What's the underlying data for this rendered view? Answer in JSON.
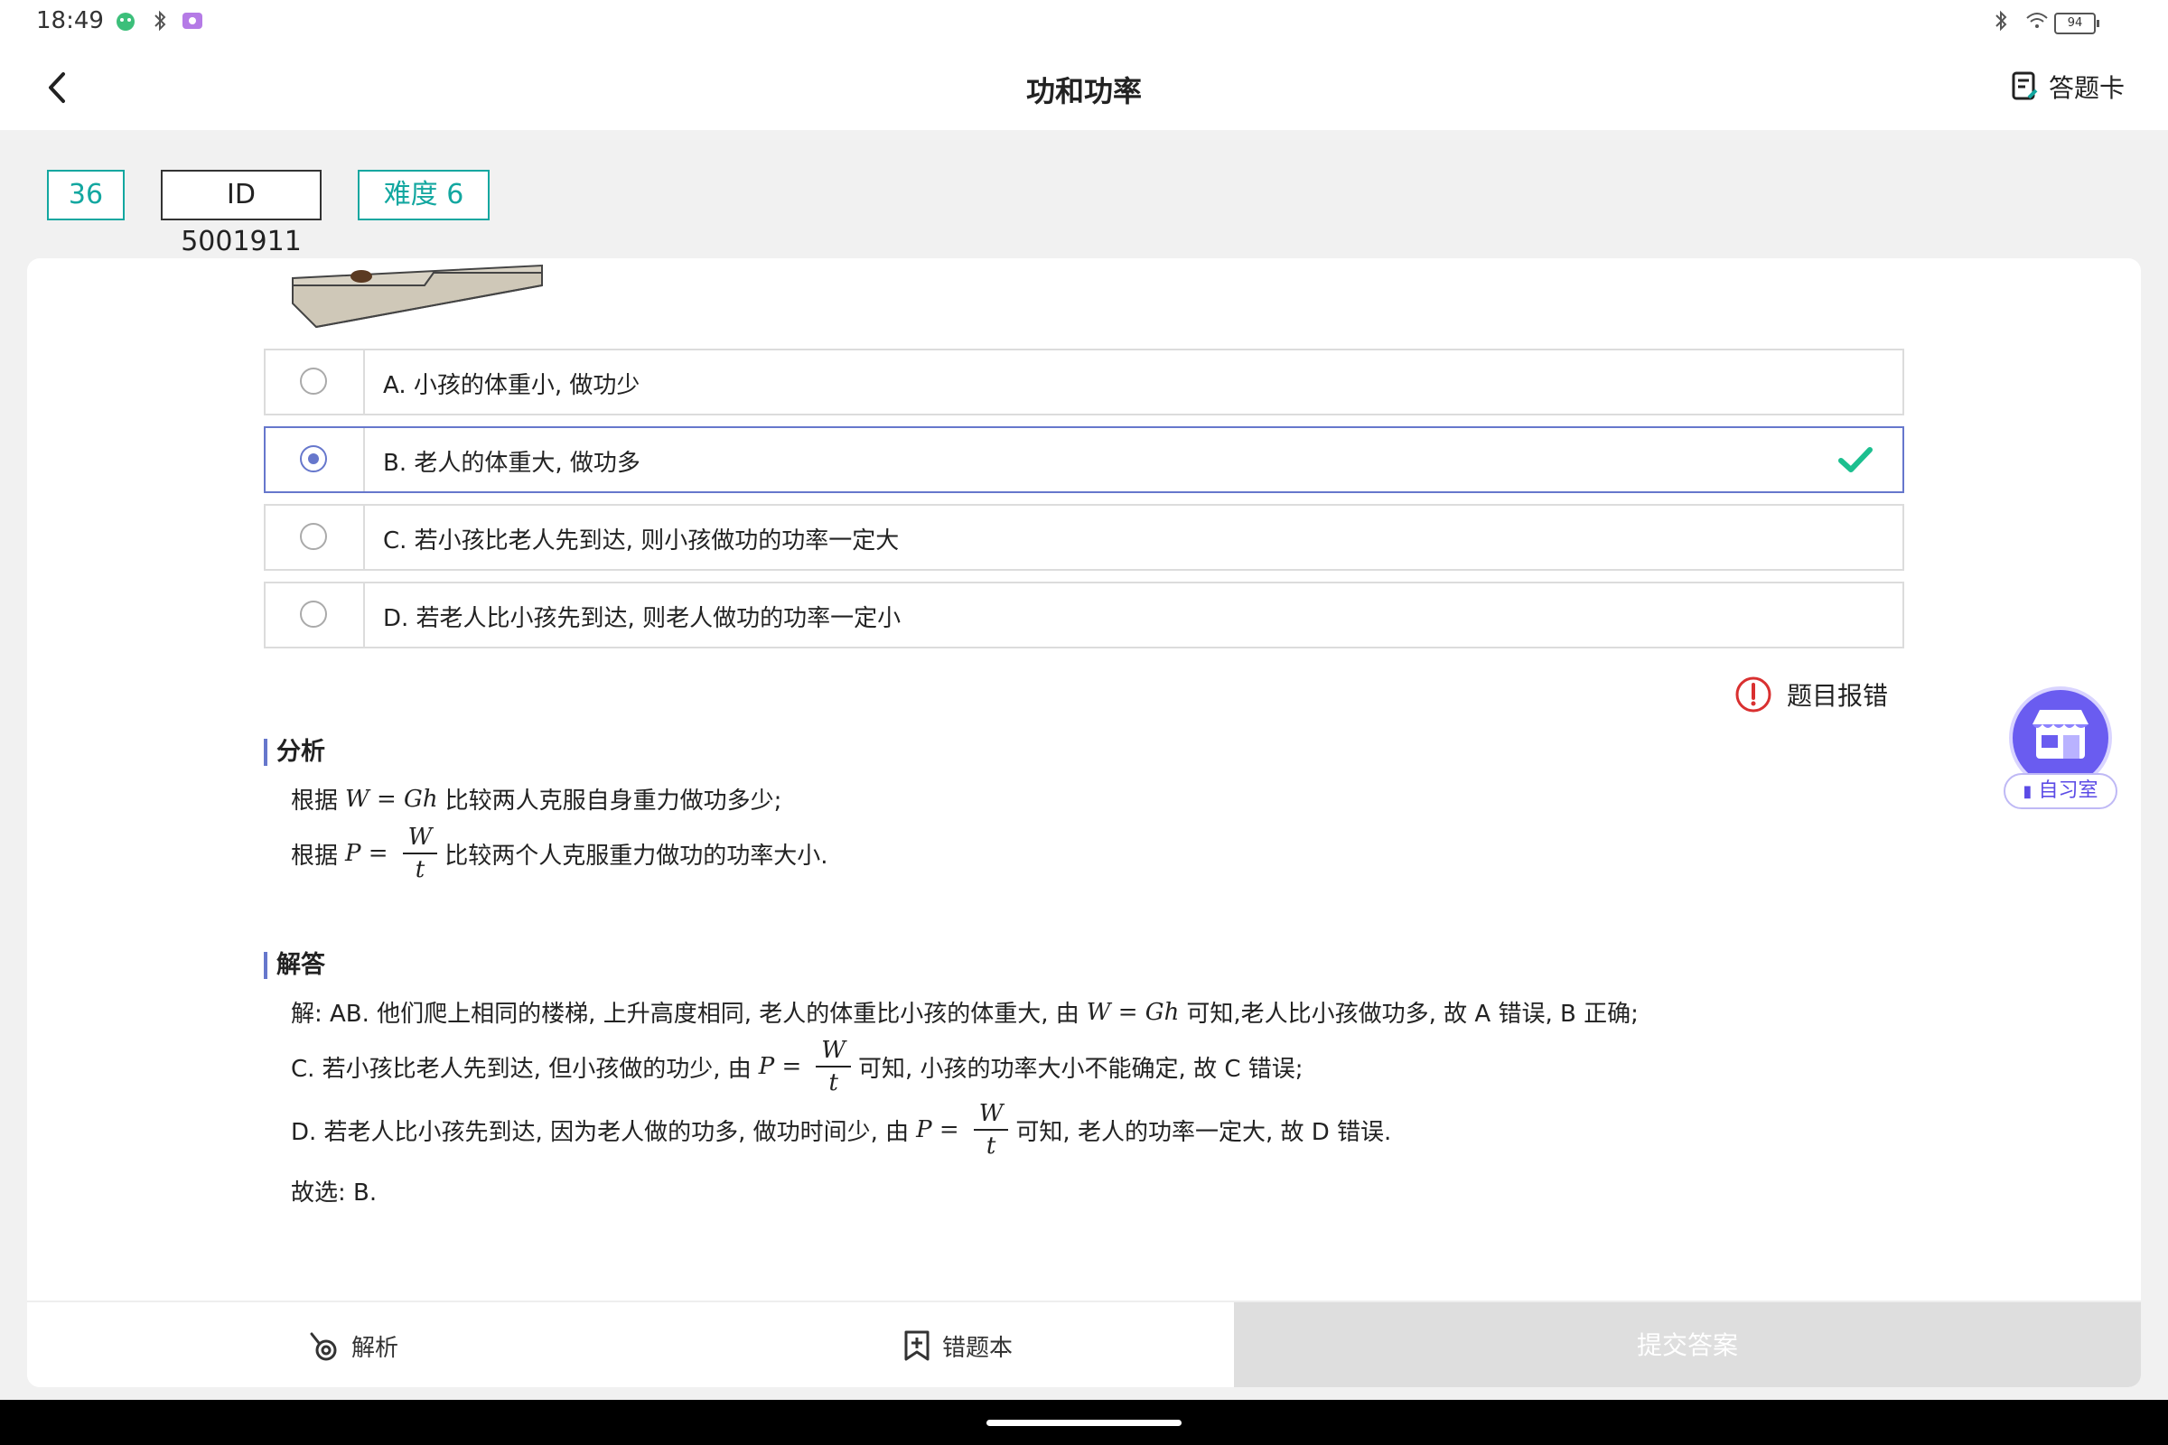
{
  "status_bar": {
    "time": "18:49",
    "battery": "94"
  },
  "header": {
    "title": "功和功率",
    "answer_card_label": "答题卡"
  },
  "tags": {
    "number": "36",
    "id": "ID 5001911",
    "difficulty": "难度 6"
  },
  "options": [
    {
      "text": "A. 小孩的体重小, 做功少",
      "selected": false
    },
    {
      "text": "B. 老人的体重大, 做功多",
      "selected": true,
      "correct": true
    },
    {
      "text": "C. 若小孩比老人先到达, 则小孩做功的功率一定大",
      "selected": false
    },
    {
      "text": "D. 若老人比小孩先到达, 则老人做功的功率一定小",
      "selected": false
    }
  ],
  "report_label": "题目报错",
  "analysis": {
    "heading": "分析",
    "line1_pre": "根据",
    "line1_formula": "W = Gh",
    "line1_post": "比较两人克服自身重力做功多少;",
    "line2_pre": "根据",
    "line2_lhs": "P =",
    "line2_num": "W",
    "line2_den": "t",
    "line2_post": "比较两个人克服重力做功的功率大小."
  },
  "solution": {
    "heading": "解答",
    "line1_pre": "解: AB. 他们爬上相同的楼梯, 上升高度相同, 老人的体重比小孩的体重大, 由",
    "line1_formula": "W = Gh",
    "line1_post": "可知,老人比小孩做功多, 故 A 错误, B 正确;",
    "line2_pre": "C. 若小孩比老人先到达, 但小孩做的功少, 由",
    "line2_lhs": "P =",
    "line2_num": "W",
    "line2_den": "t",
    "line2_post": "可知, 小孩的功率大小不能确定, 故 C 错误;",
    "line3_pre": "D. 若老人比小孩先到达, 因为老人做的功多, 做功时间少, 由",
    "line3_lhs": "P =",
    "line3_num": "W",
    "line3_den": "t",
    "line3_post": "可知, 老人的功率一定大, 故 D 错误.",
    "line4": "故选: B."
  },
  "bottom_bar": {
    "analysis_label": "解析",
    "wrongbook_label": "错题本",
    "submit_label": "提交答案"
  },
  "study_room_label": "自习室",
  "colors": {
    "accent": "#6677cc",
    "teal": "#13a7a0",
    "correct": "#1cbf8f",
    "report": "#d93030"
  }
}
